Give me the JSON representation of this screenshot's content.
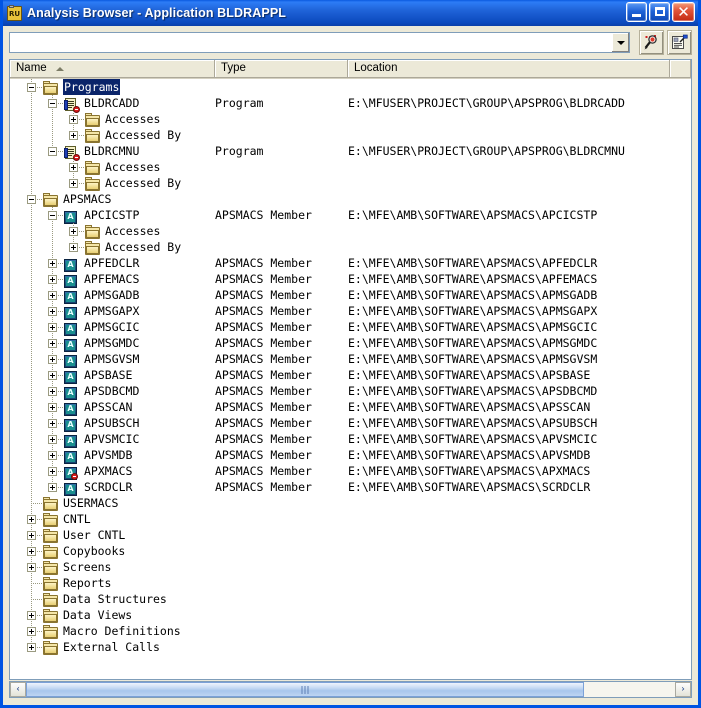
{
  "window": {
    "title": "Analysis Browser - Application BLDRAPPL",
    "app_icon": "application-icon",
    "icon_text": "RU",
    "minimize_label": "Minimize",
    "maximize_label": "Maximize",
    "close_label": "Close",
    "close_glyph": "✕"
  },
  "toolbar": {
    "search_value": "",
    "search_placeholder": "",
    "dropdown_label": "Show list",
    "find_button_label": "Find",
    "find_icon": "magnifier-icon",
    "report_button_label": "Report",
    "report_icon": "report-icon"
  },
  "columns": [
    {
      "id": "name",
      "label": "Name",
      "sorted": "asc"
    },
    {
      "id": "type",
      "label": "Type",
      "sorted": ""
    },
    {
      "id": "location",
      "label": "Location",
      "sorted": ""
    }
  ],
  "scrollbar": {
    "left_arrow": "‹",
    "right_arrow": "›",
    "thumb_position": 0
  },
  "tree": [
    {
      "depth": 0,
      "twisty": "minus",
      "icon": "folder",
      "name": "Programs",
      "type": "",
      "location": "",
      "selected": true
    },
    {
      "depth": 1,
      "twisty": "minus",
      "icon": "program",
      "name": "BLDRCADD",
      "type": "Program",
      "location": "E:\\MFUSER\\PROJECT\\GROUP\\APSPROG\\BLDRCADD",
      "selected": false
    },
    {
      "depth": 2,
      "twisty": "plus",
      "icon": "folder",
      "name": "Accesses",
      "type": "",
      "location": "",
      "selected": false
    },
    {
      "depth": 2,
      "twisty": "plus",
      "icon": "folder",
      "name": "Accessed By",
      "type": "",
      "location": "",
      "selected": false
    },
    {
      "depth": 1,
      "twisty": "minus",
      "icon": "program",
      "name": "BLDRCMNU",
      "type": "Program",
      "location": "E:\\MFUSER\\PROJECT\\GROUP\\APSPROG\\BLDRCMNU",
      "selected": false
    },
    {
      "depth": 2,
      "twisty": "plus",
      "icon": "folder",
      "name": "Accesses",
      "type": "",
      "location": "",
      "selected": false
    },
    {
      "depth": 2,
      "twisty": "plus",
      "icon": "folder",
      "name": "Accessed By",
      "type": "",
      "location": "",
      "selected": false
    },
    {
      "depth": 0,
      "twisty": "minus",
      "icon": "folder",
      "name": "APSMACS",
      "type": "",
      "location": "",
      "selected": false
    },
    {
      "depth": 1,
      "twisty": "minus",
      "icon": "member",
      "name": "APCICSTP",
      "type": "APSMACS Member",
      "location": "E:\\MFE\\AMB\\SOFTWARE\\APSMACS\\APCICSTP",
      "selected": false
    },
    {
      "depth": 2,
      "twisty": "plus",
      "icon": "folder",
      "name": "Accesses",
      "type": "",
      "location": "",
      "selected": false
    },
    {
      "depth": 2,
      "twisty": "plus",
      "icon": "folder",
      "name": "Accessed By",
      "type": "",
      "location": "",
      "selected": false
    },
    {
      "depth": 1,
      "twisty": "plus",
      "icon": "member",
      "name": "APFEDCLR",
      "type": "APSMACS Member",
      "location": "E:\\MFE\\AMB\\SOFTWARE\\APSMACS\\APFEDCLR",
      "selected": false
    },
    {
      "depth": 1,
      "twisty": "plus",
      "icon": "member",
      "name": "APFEMACS",
      "type": "APSMACS Member",
      "location": "E:\\MFE\\AMB\\SOFTWARE\\APSMACS\\APFEMACS",
      "selected": false
    },
    {
      "depth": 1,
      "twisty": "plus",
      "icon": "member",
      "name": "APMSGADB",
      "type": "APSMACS Member",
      "location": "E:\\MFE\\AMB\\SOFTWARE\\APSMACS\\APMSGADB",
      "selected": false
    },
    {
      "depth": 1,
      "twisty": "plus",
      "icon": "member",
      "name": "APMSGAPX",
      "type": "APSMACS Member",
      "location": "E:\\MFE\\AMB\\SOFTWARE\\APSMACS\\APMSGAPX",
      "selected": false
    },
    {
      "depth": 1,
      "twisty": "plus",
      "icon": "member",
      "name": "APMSGCIC",
      "type": "APSMACS Member",
      "location": "E:\\MFE\\AMB\\SOFTWARE\\APSMACS\\APMSGCIC",
      "selected": false
    },
    {
      "depth": 1,
      "twisty": "plus",
      "icon": "member",
      "name": "APMSGMDC",
      "type": "APSMACS Member",
      "location": "E:\\MFE\\AMB\\SOFTWARE\\APSMACS\\APMSGMDC",
      "selected": false
    },
    {
      "depth": 1,
      "twisty": "plus",
      "icon": "member",
      "name": "APMSGVSM",
      "type": "APSMACS Member",
      "location": "E:\\MFE\\AMB\\SOFTWARE\\APSMACS\\APMSGVSM",
      "selected": false
    },
    {
      "depth": 1,
      "twisty": "plus",
      "icon": "member",
      "name": "APSBASE",
      "type": "APSMACS Member",
      "location": "E:\\MFE\\AMB\\SOFTWARE\\APSMACS\\APSBASE",
      "selected": false
    },
    {
      "depth": 1,
      "twisty": "plus",
      "icon": "member",
      "name": "APSDBCMD",
      "type": "APSMACS Member",
      "location": "E:\\MFE\\AMB\\SOFTWARE\\APSMACS\\APSDBCMD",
      "selected": false
    },
    {
      "depth": 1,
      "twisty": "plus",
      "icon": "member",
      "name": "APSSCAN",
      "type": "APSMACS Member",
      "location": "E:\\MFE\\AMB\\SOFTWARE\\APSMACS\\APSSCAN",
      "selected": false
    },
    {
      "depth": 1,
      "twisty": "plus",
      "icon": "member",
      "name": "APSUBSCH",
      "type": "APSMACS Member",
      "location": "E:\\MFE\\AMB\\SOFTWARE\\APSMACS\\APSUBSCH",
      "selected": false
    },
    {
      "depth": 1,
      "twisty": "plus",
      "icon": "member",
      "name": "APVSMCIC",
      "type": "APSMACS Member",
      "location": "E:\\MFE\\AMB\\SOFTWARE\\APSMACS\\APVSMCIC",
      "selected": false
    },
    {
      "depth": 1,
      "twisty": "plus",
      "icon": "member",
      "name": "APVSMDB",
      "type": "APSMACS Member",
      "location": "E:\\MFE\\AMB\\SOFTWARE\\APSMACS\\APVSMDB",
      "selected": false
    },
    {
      "depth": 1,
      "twisty": "plus",
      "icon": "member-error",
      "name": "APXMACS",
      "type": "APSMACS Member",
      "location": "E:\\MFE\\AMB\\SOFTWARE\\APSMACS\\APXMACS",
      "selected": false
    },
    {
      "depth": 1,
      "twisty": "plus",
      "icon": "member",
      "name": "SCRDCLR",
      "type": "APSMACS Member",
      "location": "E:\\MFE\\AMB\\SOFTWARE\\APSMACS\\SCRDCLR",
      "selected": false
    },
    {
      "depth": 0,
      "twisty": "none",
      "icon": "folder",
      "name": "USERMACS",
      "type": "",
      "location": "",
      "selected": false
    },
    {
      "depth": 0,
      "twisty": "plus",
      "icon": "folder",
      "name": "CNTL",
      "type": "",
      "location": "",
      "selected": false
    },
    {
      "depth": 0,
      "twisty": "plus",
      "icon": "folder",
      "name": "User CNTL",
      "type": "",
      "location": "",
      "selected": false
    },
    {
      "depth": 0,
      "twisty": "plus",
      "icon": "folder",
      "name": "Copybooks",
      "type": "",
      "location": "",
      "selected": false
    },
    {
      "depth": 0,
      "twisty": "plus",
      "icon": "folder",
      "name": "Screens",
      "type": "",
      "location": "",
      "selected": false
    },
    {
      "depth": 0,
      "twisty": "none",
      "icon": "folder",
      "name": "Reports",
      "type": "",
      "location": "",
      "selected": false
    },
    {
      "depth": 0,
      "twisty": "none",
      "icon": "folder",
      "name": "Data Structures",
      "type": "",
      "location": "",
      "selected": false
    },
    {
      "depth": 0,
      "twisty": "plus",
      "icon": "folder",
      "name": "Data Views",
      "type": "",
      "location": "",
      "selected": false
    },
    {
      "depth": 0,
      "twisty": "plus",
      "icon": "folder",
      "name": "Macro Definitions",
      "type": "",
      "location": "",
      "selected": false
    },
    {
      "depth": 0,
      "twisty": "plus",
      "icon": "folder",
      "name": "External Calls",
      "type": "",
      "location": "",
      "selected": false
    }
  ]
}
